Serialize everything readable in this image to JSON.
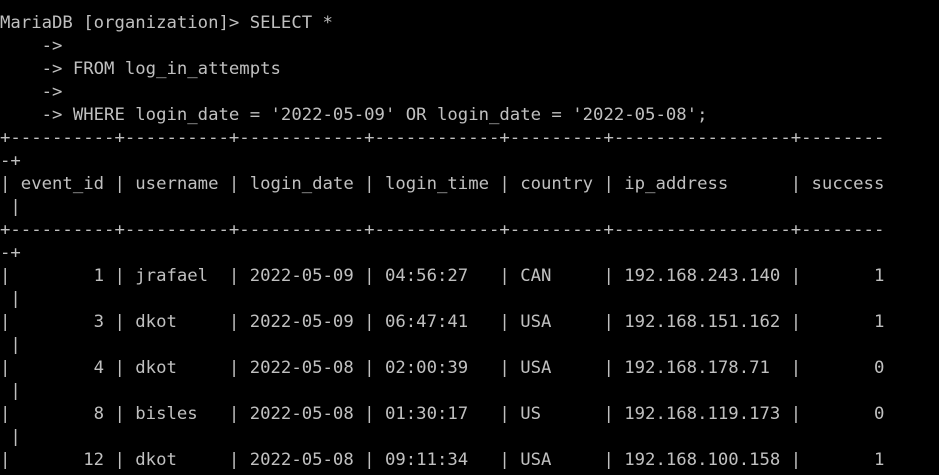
{
  "terminal": {
    "prompt": "MariaDB [organization]> ",
    "query_lines": [
      "SELECT *",
      "    ->",
      "    -> FROM log_in_attempts",
      "    ->",
      "    -> WHERE login_date = '2022-05-09' OR login_date = '2022-05-08';"
    ],
    "result": {
      "border_top_a": "+----------+----------+------------+------------+---------+-----------------+--------",
      "border_top_b": "-+",
      "header_a": "| event_id | username | login_date | login_time | country | ip_address      | success",
      "header_b": " |",
      "border_mid_a": "+----------+----------+------------+------------+---------+-----------------+--------",
      "border_mid_b": "-+",
      "columns": [
        "event_id",
        "username",
        "login_date",
        "login_time",
        "country",
        "ip_address",
        "success"
      ],
      "rows": [
        {
          "event_id": "1",
          "username": "jrafael",
          "login_date": "2022-05-09",
          "login_time": "04:56:27",
          "country": "CAN",
          "ip_address": "192.168.243.140",
          "success": "1",
          "line_a": "|        1 | jrafael  | 2022-05-09 | 04:56:27   | CAN     | 192.168.243.140 |       1",
          "line_b": " |"
        },
        {
          "event_id": "3",
          "username": "dkot",
          "login_date": "2022-05-09",
          "login_time": "06:47:41",
          "country": "USA",
          "ip_address": "192.168.151.162",
          "success": "1",
          "line_a": "|        3 | dkot     | 2022-05-09 | 06:47:41   | USA     | 192.168.151.162 |       1",
          "line_b": " |"
        },
        {
          "event_id": "4",
          "username": "dkot",
          "login_date": "2022-05-08",
          "login_time": "02:00:39",
          "country": "USA",
          "ip_address": "192.168.178.71",
          "success": "0",
          "line_a": "|        4 | dkot     | 2022-05-08 | 02:00:39   | USA     | 192.168.178.71  |       0",
          "line_b": " |"
        },
        {
          "event_id": "8",
          "username": "bisles",
          "login_date": "2022-05-08",
          "login_time": "01:30:17",
          "country": "US",
          "ip_address": "192.168.119.173",
          "success": "0",
          "line_a": "|        8 | bisles   | 2022-05-08 | 01:30:17   | US      | 192.168.119.173 |       0",
          "line_b": " |"
        },
        {
          "event_id": "12",
          "username": "dkot",
          "login_date": "2022-05-08",
          "login_time": "09:11:34",
          "country": "USA",
          "ip_address": "192.168.100.158",
          "success": "1",
          "line_a": "|       12 | dkot     | 2022-05-08 | 09:11:34   | USA     | 192.168.100.158 |       1",
          "line_b": ""
        }
      ]
    }
  }
}
